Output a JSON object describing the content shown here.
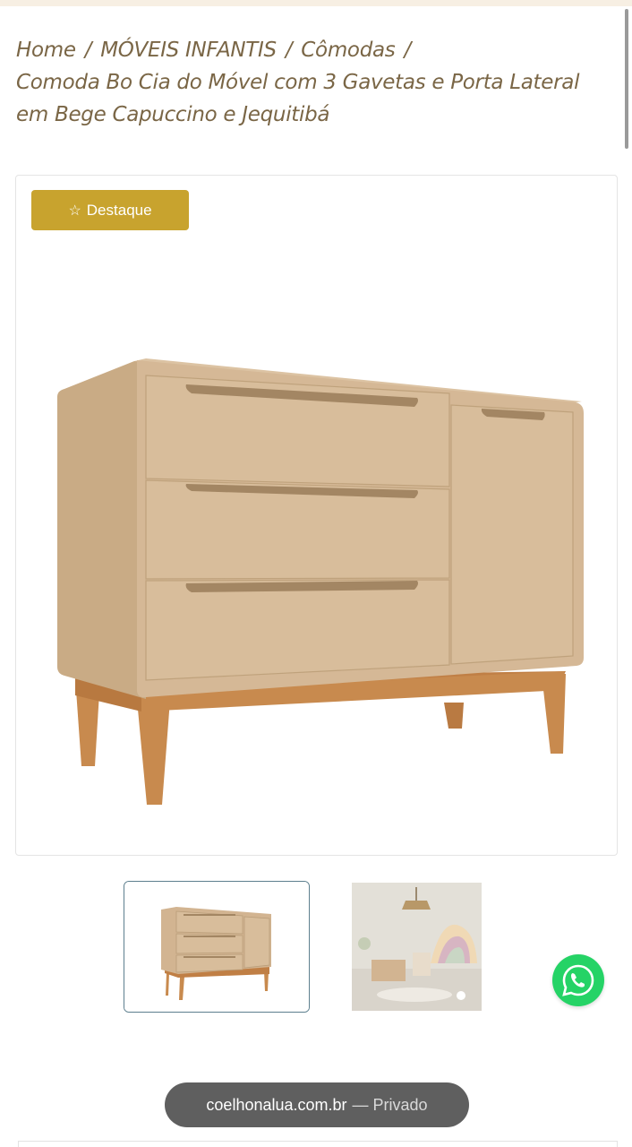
{
  "breadcrumb": {
    "home": "Home",
    "category": "MÓVEIS INFANTIS",
    "subcategory": "Cômodas",
    "separator": "/",
    "product": "Comoda Bo Cia do Móvel com 3 Gavetas e Porta Lateral em Bege Capuccino e Jequitibá"
  },
  "gallery": {
    "badge_label": "Destaque",
    "badge_icon": "star-outline-icon"
  },
  "browser": {
    "domain": "coelhonalua.com.br",
    "mode": "— Privado"
  },
  "colors": {
    "badge": "#c8a32e",
    "breadcrumb_text": "#7a6646",
    "furniture_body": "#d2b491",
    "furniture_wood": "#c88a4e",
    "whatsapp": "#25d366",
    "thumb_border": "#5d7f8e"
  }
}
